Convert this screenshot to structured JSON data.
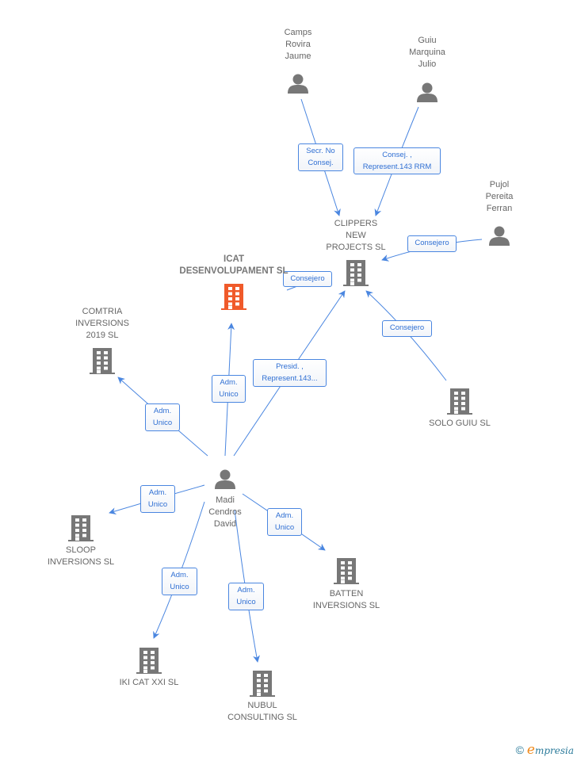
{
  "colors": {
    "edge": "#4a86e0",
    "node_icon": "#777777",
    "main_node": "#f05a2a"
  },
  "nodes": [
    {
      "id": "camps",
      "type": "person",
      "label": [
        "Camps",
        "Rovira",
        "Jaume"
      ]
    },
    {
      "id": "guiu",
      "type": "person",
      "label": [
        "Guiu",
        "Marquina",
        "Julio"
      ]
    },
    {
      "id": "pujol",
      "type": "person",
      "label": [
        "Pujol",
        "Pereita",
        "Ferran"
      ]
    },
    {
      "id": "clippers",
      "type": "company",
      "label": [
        "CLIPPERS",
        "NEW",
        "PROJECTS SL"
      ]
    },
    {
      "id": "icat",
      "type": "company",
      "main": true,
      "label": [
        "ICAT",
        "DESENVOLUPAMENT SL"
      ]
    },
    {
      "id": "comtria",
      "type": "company",
      "label": [
        "COMTRIA",
        "INVERSIONS",
        "2019 SL"
      ]
    },
    {
      "id": "solo",
      "type": "company",
      "label": [
        "SOLO GUIU SL"
      ]
    },
    {
      "id": "madi",
      "type": "person",
      "label": [
        "Madi",
        "Cendros",
        "David"
      ]
    },
    {
      "id": "sloop",
      "type": "company",
      "label": [
        "SLOOP",
        "INVERSIONS SL"
      ]
    },
    {
      "id": "batten",
      "type": "company",
      "label": [
        "BATTEN",
        "INVERSIONS SL"
      ]
    },
    {
      "id": "iki",
      "type": "company",
      "label": [
        "IKI CAT XXI SL"
      ]
    },
    {
      "id": "nubul",
      "type": "company",
      "label": [
        "NUBUL",
        "CONSULTING SL"
      ]
    }
  ],
  "edges": [
    {
      "from": "camps",
      "to": "clippers",
      "label": [
        "Secr.  No",
        "Consej."
      ]
    },
    {
      "from": "guiu",
      "to": "clippers",
      "label": [
        "Consej. ,",
        "Represent.143 RRM"
      ]
    },
    {
      "from": "pujol",
      "to": "clippers",
      "label": [
        "Consejero"
      ]
    },
    {
      "from": "icat",
      "to": "clippers",
      "label": [
        "Consejero"
      ]
    },
    {
      "from": "madi",
      "to": "clippers",
      "label": [
        "Presid. ,",
        "Represent.143..."
      ]
    },
    {
      "from": "solo",
      "to": "clippers",
      "label": [
        "Consejero"
      ]
    },
    {
      "from": "madi",
      "to": "icat",
      "label": [
        "Adm.",
        "Unico"
      ]
    },
    {
      "from": "madi",
      "to": "comtria",
      "label": [
        "Adm.",
        "Unico"
      ]
    },
    {
      "from": "madi",
      "to": "sloop",
      "label": [
        "Adm.",
        "Unico"
      ]
    },
    {
      "from": "madi",
      "to": "batten",
      "label": [
        "Adm.",
        "Unico"
      ]
    },
    {
      "from": "madi",
      "to": "iki",
      "label": [
        "Adm.",
        "Unico"
      ]
    },
    {
      "from": "madi",
      "to": "nubul",
      "label": [
        "Adm.",
        "Unico"
      ]
    }
  ],
  "footer": {
    "copyright": "©",
    "brand_initial": "e",
    "brand_rest": "mpresia"
  }
}
